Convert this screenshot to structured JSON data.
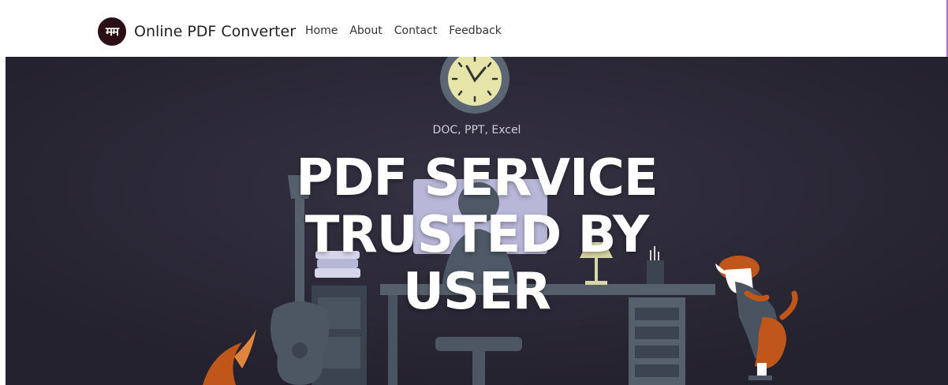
{
  "colors": {
    "hero_background": "#2a2735",
    "logo_background": "#2a0f14",
    "accent_dog": "#c0561a",
    "furniture": "#4d5663"
  },
  "navbar": {
    "logo_text": "मम",
    "brand_name": "Online PDF Converter",
    "links": [
      {
        "label": "Home"
      },
      {
        "label": "About"
      },
      {
        "label": "Contact"
      },
      {
        "label": "Feedback"
      }
    ]
  },
  "hero": {
    "tagline": "DOC, PPT, Excel",
    "title_lines": [
      "PDF SERVICE",
      "TRUSTED BY",
      "USER"
    ]
  }
}
